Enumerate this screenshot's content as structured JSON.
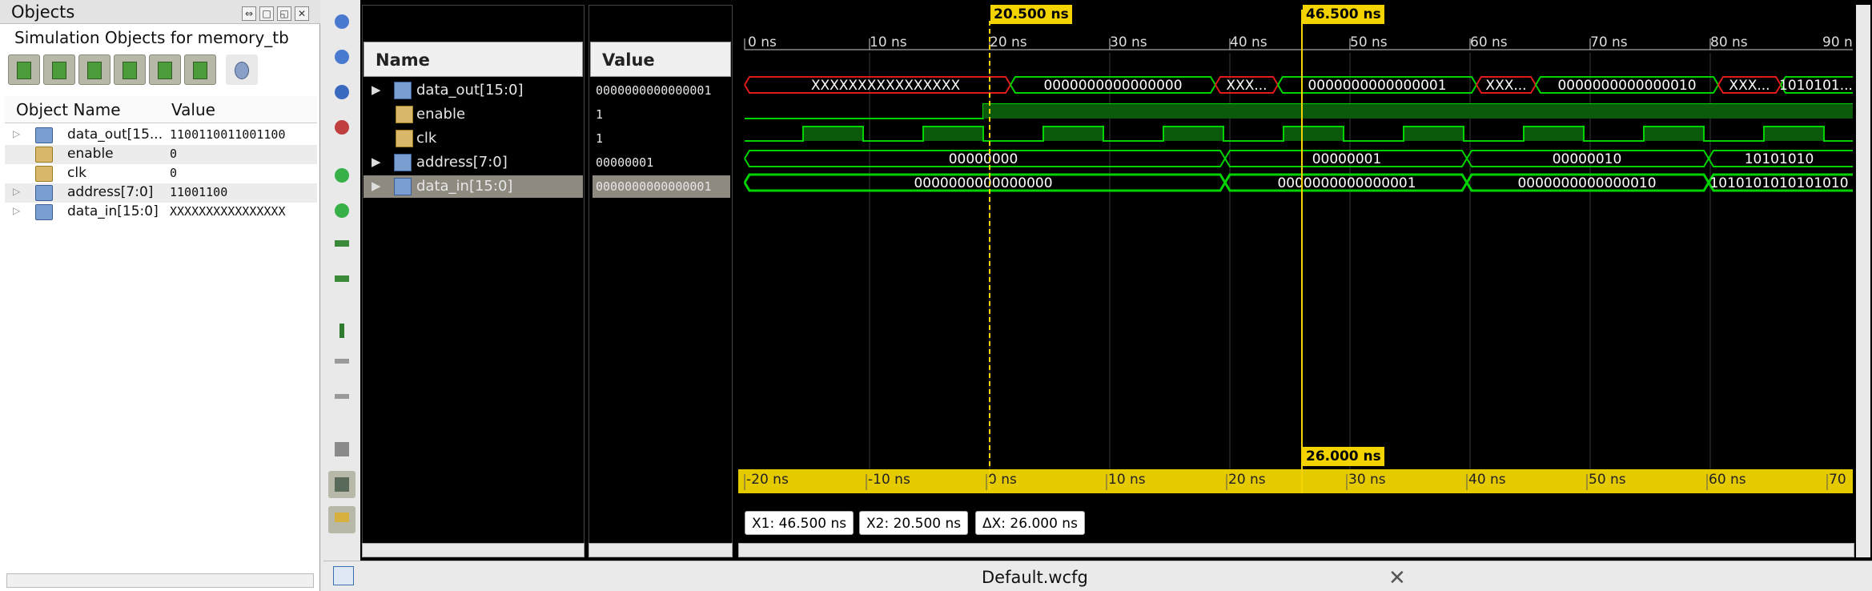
{
  "objects_panel": {
    "title": "Objects",
    "subtitle": "Simulation Objects for memory_tb",
    "col_name": "Object Name",
    "col_value": "Value",
    "items": [
      {
        "name": "data_out[15...",
        "value": "1100110011001100",
        "icon": "bus-icon",
        "expandable": true
      },
      {
        "name": "enable",
        "value": "0",
        "icon": "bit-icon",
        "expandable": false
      },
      {
        "name": "clk",
        "value": "0",
        "icon": "bit-icon",
        "expandable": false
      },
      {
        "name": "address[7:0]",
        "value": "11001100",
        "icon": "bus-icon",
        "expandable": true
      },
      {
        "name": "data_in[15:0]",
        "value": "XXXXXXXXXXXXXXXX",
        "icon": "bus-icon",
        "expandable": true
      }
    ]
  },
  "wave": {
    "name_header": "Name",
    "value_header": "Value",
    "signals": [
      {
        "name": "data_out[15:0]",
        "value": "0000000000000001",
        "expandable": true
      },
      {
        "name": "enable",
        "value": "1",
        "expandable": false
      },
      {
        "name": "clk",
        "value": "1",
        "expandable": false
      },
      {
        "name": "address[7:0]",
        "value": "00000001",
        "expandable": true
      },
      {
        "name": "data_in[15:0]",
        "value": "0000000000000001",
        "expandable": true
      }
    ],
    "time_ticks": [
      "0 ns",
      "10 ns",
      "20 ns",
      "30 ns",
      "40 ns",
      "50 ns",
      "60 ns",
      "70 ns",
      "80 ns",
      "90 n"
    ],
    "relative_ticks": [
      "-20 ns",
      "-10 ns",
      "0 ns",
      "10 ns",
      "20 ns",
      "30 ns",
      "40 ns",
      "50 ns",
      "60 ns",
      "70"
    ],
    "cursor1_label": "20.500 ns",
    "cursor2_label": "46.500 ns",
    "delta_label": "26.000 ns",
    "data_out_segments": [
      "XXXXXXXXXXXXXXXX",
      "0000000000000000",
      "XXX...",
      "0000000000000001",
      "XXX...",
      "0000000000000010",
      "XXX...",
      "1010101..."
    ],
    "address_segments": [
      "00000000",
      "00000001",
      "00000010",
      "10101010"
    ],
    "data_in_segments": [
      "0000000000000000",
      "0000000000000001",
      "0000000000000010",
      "1010101010101010"
    ],
    "x1": "X1: 46.500 ns",
    "x2": "X2: 20.500 ns",
    "dx": "ΔX: 26.000 ns"
  },
  "tab": {
    "label": "Default.wcfg"
  },
  "colors": {
    "wave_green": "#00d400",
    "unknown_red": "#e11a1a",
    "cursor_yellow": "#f4d400"
  }
}
